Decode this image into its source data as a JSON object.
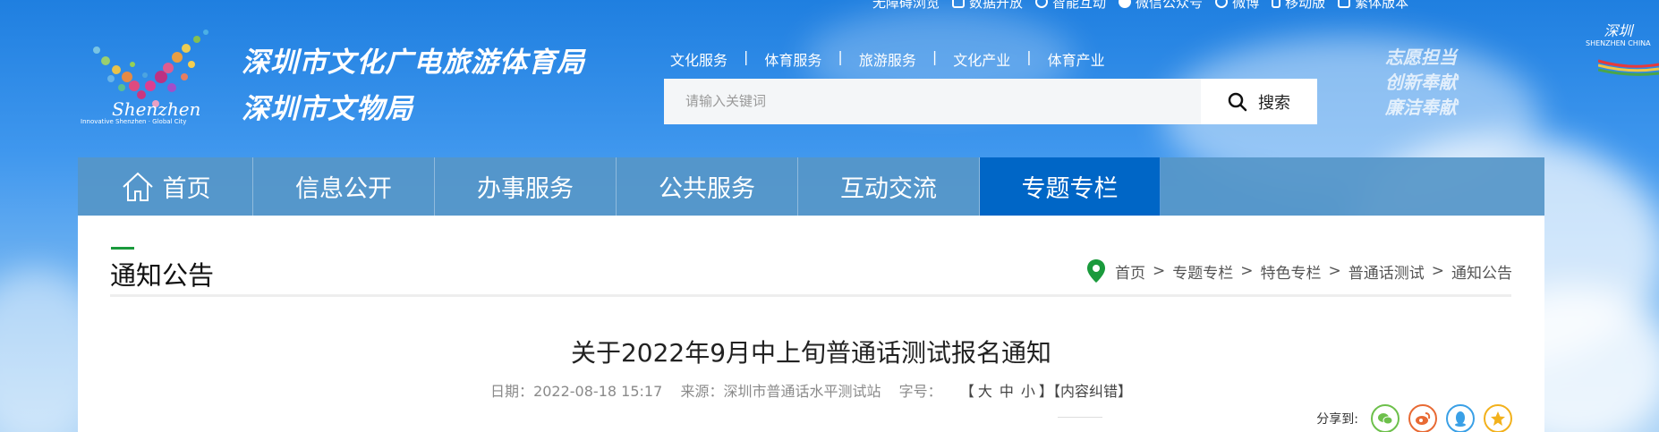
{
  "topbar": {
    "items": [
      {
        "label": "无障碍浏览",
        "icon": "accessibility-icon"
      },
      {
        "label": "数据开放",
        "icon": "data-bars-icon"
      },
      {
        "label": "智能互动",
        "icon": "chat-bubble-icon"
      },
      {
        "label": "微信公众号",
        "icon": "wechat-icon"
      },
      {
        "label": "微博",
        "icon": "weibo-icon"
      },
      {
        "label": "移动版",
        "icon": "mobile-phone-icon"
      },
      {
        "label": "繁体版本",
        "icon": "traditional-chinese-icon"
      }
    ]
  },
  "header": {
    "logo_text": "Shenzhen",
    "logo_tagline": "Innovative Shenzhen · Global City",
    "dept_name_1": "深圳市文化广电旅游体育局",
    "dept_name_2": "深圳市文物局",
    "slogan": [
      "志愿担当",
      "创新奉献",
      "廉洁奉献"
    ],
    "corner_logo_text": "深圳",
    "corner_logo_sub": "SHENZHEN CHINA"
  },
  "quicklinks": {
    "items": [
      "文化服务",
      "体育服务",
      "旅游服务",
      "文化产业",
      "体育产业"
    ],
    "separator": "|"
  },
  "search": {
    "placeholder": "请输入关键词",
    "value": "",
    "button_label": "搜索"
  },
  "nav": {
    "items": [
      {
        "label": "首页",
        "active": false
      },
      {
        "label": "信息公开",
        "active": false
      },
      {
        "label": "办事服务",
        "active": false
      },
      {
        "label": "公共服务",
        "active": false
      },
      {
        "label": "互动交流",
        "active": false
      },
      {
        "label": "专题专栏",
        "active": true
      }
    ]
  },
  "section": {
    "title": "通知公告"
  },
  "breadcrumb": {
    "items": [
      "首页",
      "专题专栏",
      "特色专栏",
      "普通话测试",
      "通知公告"
    ],
    "separator": ">"
  },
  "article": {
    "title": "关于2022年9月中上旬普通话测试报名通知",
    "date_label": "日期：",
    "date": "2022-08-18 15:17",
    "source_label": "来源：",
    "source": "深圳市普通话水平测试站",
    "fontsize_label": "字号：",
    "fontsize_open": "【",
    "fontsize_options": [
      "大",
      "中",
      "小"
    ],
    "fontsize_close": "】",
    "error_report": "【内容纠错】"
  },
  "share": {
    "label": "分享到:",
    "targets": [
      "wechat",
      "weibo",
      "qq",
      "favorite"
    ]
  },
  "colors": {
    "nav_bg": "#5696c8",
    "nav_active": "#0066c6",
    "accent_green": "#1a9a3c",
    "panel_bg": "#ffffff"
  }
}
